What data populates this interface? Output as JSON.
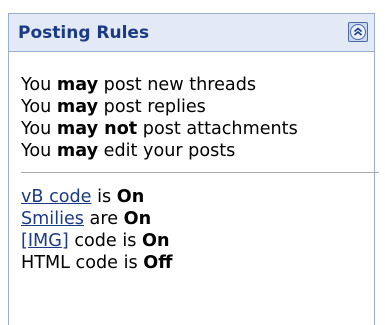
{
  "panel": {
    "title": "Posting Rules",
    "collapse_icon": "collapse-up-chevrons-icon"
  },
  "permissions": [
    {
      "prefix": "You ",
      "status": "may",
      "suffix": " post new threads"
    },
    {
      "prefix": "You ",
      "status": "may",
      "suffix": " post replies"
    },
    {
      "prefix": "You ",
      "status": "may not",
      "suffix": " post attachments"
    },
    {
      "prefix": "You ",
      "status": "may",
      "suffix": " edit your posts"
    }
  ],
  "codes": [
    {
      "name": "vB code",
      "is_link": true,
      "verb": " is ",
      "state": "On"
    },
    {
      "name": "Smilies",
      "is_link": true,
      "verb": " are ",
      "state": "On"
    },
    {
      "name": "[IMG]",
      "is_link": true,
      "verb": " code is ",
      "state": "On"
    },
    {
      "name": "HTML code",
      "is_link": false,
      "verb": " is ",
      "state": "Off"
    }
  ],
  "colors": {
    "header_bg": "#e3eaf6",
    "title": "#1b3a84",
    "border": "#9aaecf",
    "link": "#1b3a84"
  }
}
